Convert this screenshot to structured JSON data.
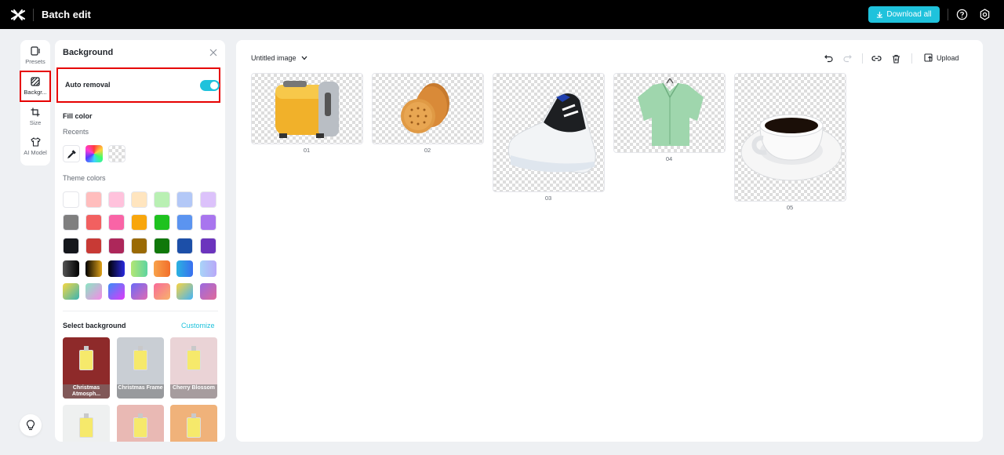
{
  "app": {
    "title": "Batch edit",
    "download_label": "Download all"
  },
  "nav": {
    "items": [
      {
        "label": "Presets",
        "icon": "presets-icon"
      },
      {
        "label": "Backgr...",
        "icon": "background-icon"
      },
      {
        "label": "Size",
        "icon": "crop-icon"
      },
      {
        "label": "AI Model",
        "icon": "shirt-icon"
      }
    ]
  },
  "panel": {
    "title": "Background",
    "auto_removal_label": "Auto removal",
    "auto_removal_on": true,
    "fill_color_title": "Fill color",
    "recents_label": "Recents",
    "theme_colors_label": "Theme colors",
    "select_background_title": "Select background",
    "customize_label": "Customize",
    "theme_rows": [
      [
        "#ffffff",
        "#ffbdbd",
        "#ffc2dc",
        "#ffe5bf",
        "#b9f0b3",
        "#b3c8f7",
        "#dcc2fb"
      ],
      [
        "#7f7f7f",
        "#f26060",
        "#f964a6",
        "#f8a60c",
        "#1ec21f",
        "#5b94f0",
        "#a875ee"
      ],
      [
        "#15171c",
        "#c83a35",
        "#ad275a",
        "#9a6a05",
        "#10780a",
        "#1c4fa8",
        "#6b34bd"
      ],
      [
        "linear-gradient(90deg,#555,#000)",
        "linear-gradient(90deg,#000,#e0a218)",
        "linear-gradient(90deg,#000,#2a2ae0)",
        "linear-gradient(90deg,#b3e675,#5ed4a0)",
        "linear-gradient(90deg,#f8a24a,#f26f2b)",
        "linear-gradient(90deg,#2ab3e0,#3a6ef0)",
        "linear-gradient(90deg,#a8d4f8,#b8a8f8)"
      ],
      [
        "linear-gradient(135deg,#f5d742,#3bb3b3)",
        "linear-gradient(135deg,#8ae6c3,#f58ae6)",
        "linear-gradient(135deg,#3a8cf8,#e03af8)",
        "linear-gradient(135deg,#6a6af8,#e06ab3)",
        "linear-gradient(135deg,#f86a9a,#f8b36a)",
        "linear-gradient(135deg,#f8d442,#42b3f8)",
        "linear-gradient(135deg,#9a6ae0,#e06a9a)"
      ]
    ],
    "backgrounds": [
      {
        "label": "Christmas Atmosph...",
        "bg": "#8e2a2a"
      },
      {
        "label": "Christmas Frame",
        "bg": "#c9ced4"
      },
      {
        "label": "Cherry Blossom",
        "bg": "#ead3d6"
      },
      {
        "label": "",
        "bg": "#eef0f0"
      },
      {
        "label": "",
        "bg": "#e9b9b4"
      },
      {
        "label": "",
        "bg": "#f0b27a"
      }
    ]
  },
  "canvas": {
    "doc_name": "Untitled image",
    "upload_label": "Upload",
    "images": [
      {
        "label": "01",
        "subject": "toaster"
      },
      {
        "label": "02",
        "subject": "crackers"
      },
      {
        "label": "03",
        "subject": "sneaker"
      },
      {
        "label": "04",
        "subject": "shirt"
      },
      {
        "label": "05",
        "subject": "coffee-cup"
      }
    ]
  }
}
